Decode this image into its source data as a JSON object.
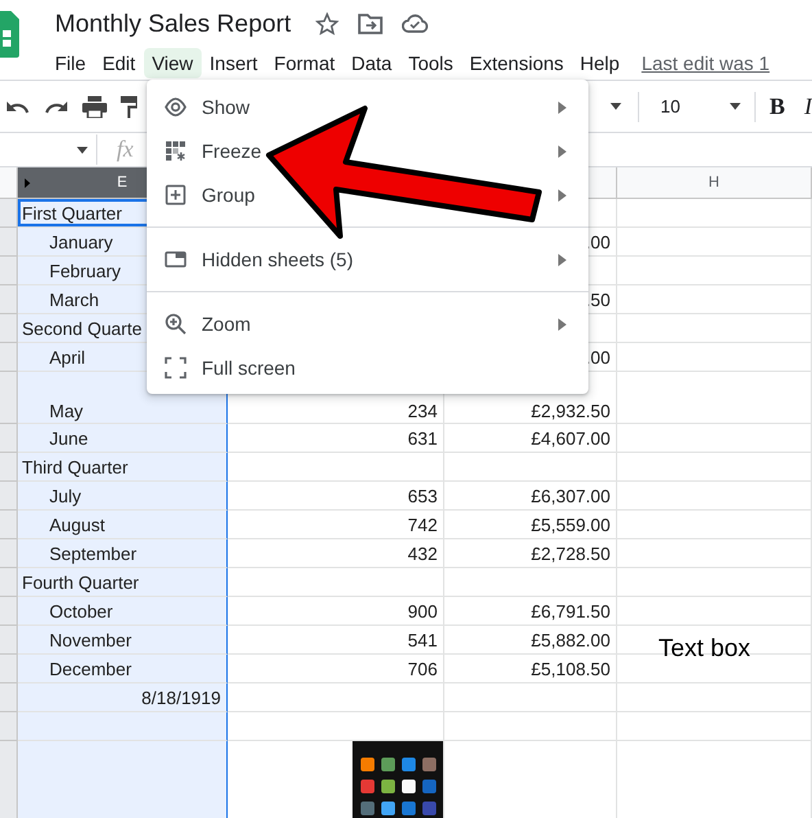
{
  "document": {
    "title": "Monthly Sales Report",
    "last_edit": "Last edit was 1"
  },
  "menu_bar": [
    {
      "label": "File",
      "selected": false
    },
    {
      "label": "Edit",
      "selected": false
    },
    {
      "label": "View",
      "selected": true
    },
    {
      "label": "Insert",
      "selected": false
    },
    {
      "label": "Format",
      "selected": false
    },
    {
      "label": "Data",
      "selected": false
    },
    {
      "label": "Tools",
      "selected": false
    },
    {
      "label": "Extensions",
      "selected": false
    },
    {
      "label": "Help",
      "selected": false
    }
  ],
  "toolbar": {
    "font_size": "10",
    "bold": "B",
    "italic": "I"
  },
  "formula_bar": {
    "function_label": "fx"
  },
  "columns": [
    {
      "label": "E",
      "selected": true
    },
    {
      "label": "H",
      "selected": false
    }
  ],
  "rows": [
    {
      "kind": "heading",
      "label": "First Quarter",
      "active": true,
      "tall": false
    },
    {
      "kind": "month",
      "label": "January",
      "amount": ".00",
      "active": false,
      "tall": false
    },
    {
      "kind": "month",
      "label": "February",
      "active": false,
      "tall": false
    },
    {
      "kind": "month",
      "label": "March",
      "amount": ".50",
      "active": false,
      "tall": false
    },
    {
      "kind": "heading",
      "label": "Second Quarte",
      "active": false,
      "tall": false
    },
    {
      "kind": "month",
      "label": "April",
      "amount": ".00",
      "active": false,
      "tall": false
    },
    {
      "kind": "month",
      "label": "May",
      "count": "234",
      "amount": "£2,932.50",
      "active": false,
      "tall": true
    },
    {
      "kind": "month",
      "label": "June",
      "count": "631",
      "amount": "£4,607.00",
      "active": false,
      "tall": false
    },
    {
      "kind": "heading",
      "label": "Third Quarter",
      "active": false,
      "tall": false
    },
    {
      "kind": "month",
      "label": "July",
      "count": "653",
      "amount": "£6,307.00",
      "active": false,
      "tall": false
    },
    {
      "kind": "month",
      "label": "August",
      "count": "742",
      "amount": "£5,559.00",
      "active": false,
      "tall": false
    },
    {
      "kind": "month",
      "label": "September",
      "count": "432",
      "amount": "£2,728.50",
      "active": false,
      "tall": false
    },
    {
      "kind": "heading",
      "label": "Fourth Quarter",
      "active": false,
      "tall": false
    },
    {
      "kind": "month",
      "label": "October",
      "count": "900",
      "amount": "£6,791.50",
      "active": false,
      "tall": false
    },
    {
      "kind": "month",
      "label": "November",
      "count": "541",
      "amount": "£5,882.00",
      "active": false,
      "tall": false
    },
    {
      "kind": "month",
      "label": "December",
      "count": "706",
      "amount": "£5,108.50",
      "active": false,
      "tall": false
    },
    {
      "kind": "date",
      "label": "8/18/1919",
      "active": false,
      "tall": false
    },
    {
      "kind": "blank",
      "active": false,
      "tall": false
    },
    {
      "kind": "picture",
      "active": false,
      "tall": false
    }
  ],
  "text_box": {
    "text": "Text box"
  },
  "view_menu": [
    {
      "kind": "item",
      "label": "Show",
      "submenu": true
    },
    {
      "kind": "item",
      "label": "Freeze",
      "submenu": true
    },
    {
      "kind": "item",
      "label": "Group",
      "submenu": true
    },
    {
      "kind": "divider"
    },
    {
      "kind": "item",
      "label": "Hidden sheets (5)",
      "submenu": true
    },
    {
      "kind": "divider"
    },
    {
      "kind": "item",
      "label": "Zoom",
      "submenu": true
    },
    {
      "kind": "item",
      "label": "Full screen",
      "submenu": false
    }
  ]
}
